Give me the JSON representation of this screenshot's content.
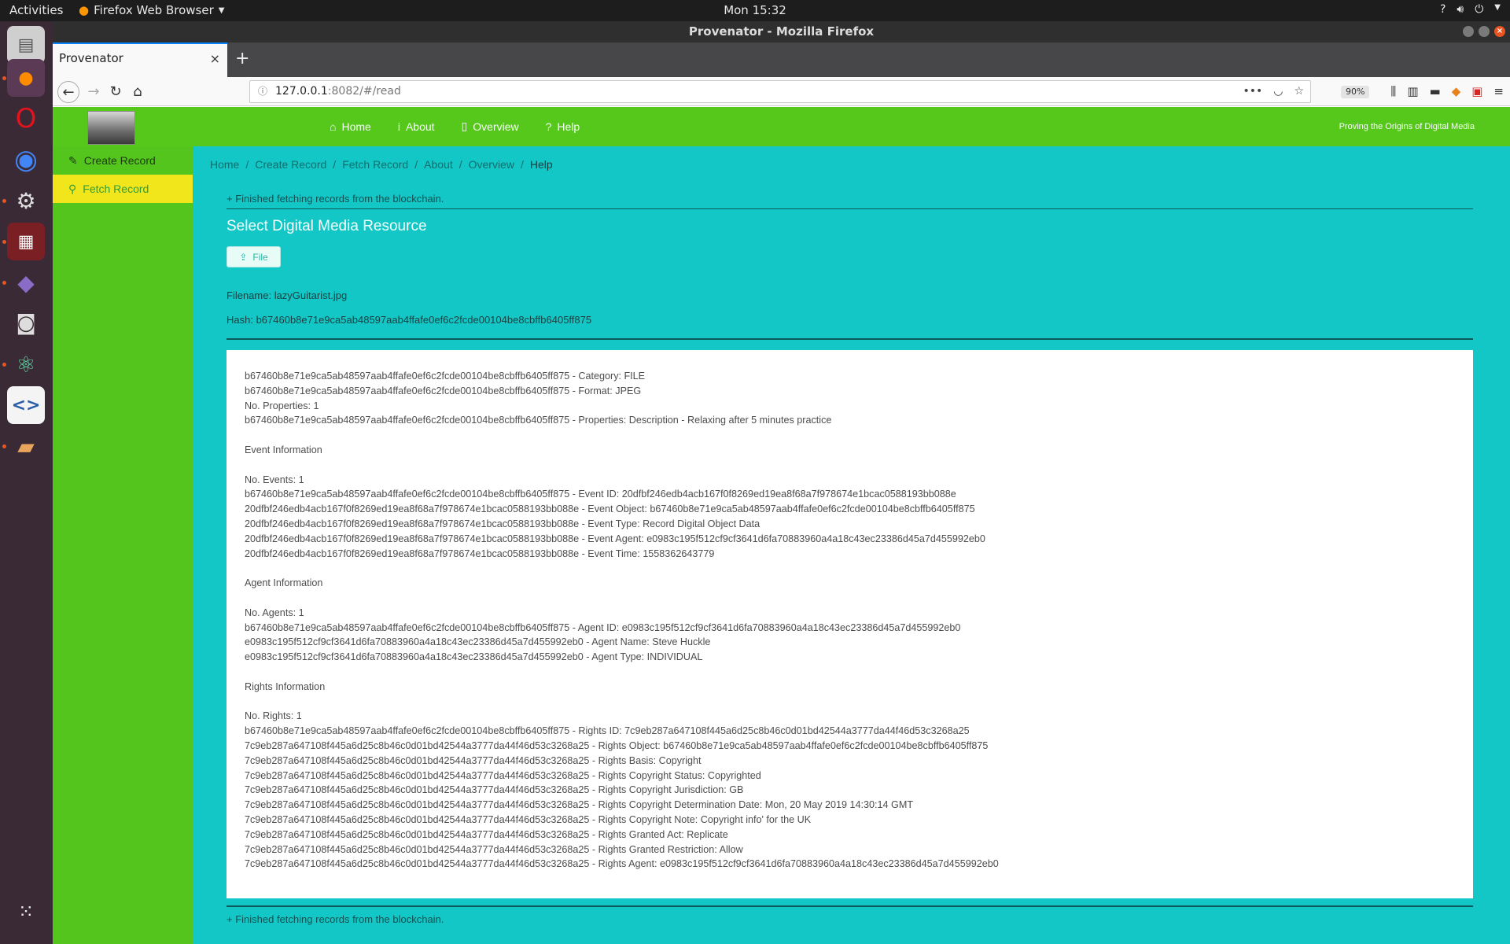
{
  "topbar": {
    "activities": "Activities",
    "app_name": "Firefox Web Browser",
    "clock": "Mon 15:32"
  },
  "window": {
    "title": "Provenator - Mozilla Firefox",
    "tab_title": "Provenator",
    "url_host": "127.0.0.1",
    "url_rest": ":8082/#/read",
    "zoom": "90%"
  },
  "header": {
    "nav": [
      "Home",
      "About",
      "Overview",
      "Help"
    ],
    "tagline": "Proving the Origins of Digital Media"
  },
  "sidebar": {
    "items": [
      "Create Record",
      "Fetch Record"
    ],
    "active_index": 1
  },
  "breadcrumb": [
    "Home",
    "Create Record",
    "Fetch Record",
    "About",
    "Overview",
    "Help"
  ],
  "main": {
    "status_top": "Finished fetching records from the blockchain.",
    "status_bottom": "Finished fetching records from the blockchain.",
    "title": "Select Digital Media Resource",
    "file_button": "File",
    "filename": "Filename: lazyGuitarist.jpg",
    "hash": "Hash: b67460b8e71e9ca5ab48597aab4ffafe0ef6c2fcde00104be8cbffb6405ff875",
    "result_lines": [
      "b67460b8e71e9ca5ab48597aab4ffafe0ef6c2fcde00104be8cbffb6405ff875 - Category: FILE",
      "b67460b8e71e9ca5ab48597aab4ffafe0ef6c2fcde00104be8cbffb6405ff875 - Format: JPEG",
      "No. Properties: 1",
      "b67460b8e71e9ca5ab48597aab4ffafe0ef6c2fcde00104be8cbffb6405ff875 - Properties: Description - Relaxing after 5 minutes practice",
      "",
      "Event Information",
      "",
      "No. Events: 1",
      "b67460b8e71e9ca5ab48597aab4ffafe0ef6c2fcde00104be8cbffb6405ff875 - Event ID: 20dfbf246edb4acb167f0f8269ed19ea8f68a7f978674e1bcac0588193bb088e",
      "20dfbf246edb4acb167f0f8269ed19ea8f68a7f978674e1bcac0588193bb088e - Event Object: b67460b8e71e9ca5ab48597aab4ffafe0ef6c2fcde00104be8cbffb6405ff875",
      "20dfbf246edb4acb167f0f8269ed19ea8f68a7f978674e1bcac0588193bb088e - Event Type: Record Digital Object Data",
      "20dfbf246edb4acb167f0f8269ed19ea8f68a7f978674e1bcac0588193bb088e - Event Agent: e0983c195f512cf9cf3641d6fa70883960a4a18c43ec23386d45a7d455992eb0",
      "20dfbf246edb4acb167f0f8269ed19ea8f68a7f978674e1bcac0588193bb088e - Event Time: 1558362643779",
      "",
      "Agent Information",
      "",
      "No. Agents: 1",
      "b67460b8e71e9ca5ab48597aab4ffafe0ef6c2fcde00104be8cbffb6405ff875 - Agent ID: e0983c195f512cf9cf3641d6fa70883960a4a18c43ec23386d45a7d455992eb0",
      "e0983c195f512cf9cf3641d6fa70883960a4a18c43ec23386d45a7d455992eb0 - Agent Name: Steve Huckle",
      "e0983c195f512cf9cf3641d6fa70883960a4a18c43ec23386d45a7d455992eb0 - Agent Type: INDIVIDUAL",
      "",
      "Rights Information",
      "",
      "No. Rights: 1",
      "b67460b8e71e9ca5ab48597aab4ffafe0ef6c2fcde00104be8cbffb6405ff875 - Rights ID: 7c9eb287a647108f445a6d25c8b46c0d01bd42544a3777da44f46d53c3268a25",
      "7c9eb287a647108f445a6d25c8b46c0d01bd42544a3777da44f46d53c3268a25 - Rights Object: b67460b8e71e9ca5ab48597aab4ffafe0ef6c2fcde00104be8cbffb6405ff875",
      "7c9eb287a647108f445a6d25c8b46c0d01bd42544a3777da44f46d53c3268a25 - Rights Basis: Copyright",
      "7c9eb287a647108f445a6d25c8b46c0d01bd42544a3777da44f46d53c3268a25 - Rights Copyright Status: Copyrighted",
      "7c9eb287a647108f445a6d25c8b46c0d01bd42544a3777da44f46d53c3268a25 - Rights Copyright Jurisdiction: GB",
      "7c9eb287a647108f445a6d25c8b46c0d01bd42544a3777da44f46d53c3268a25 - Rights Copyright Determination Date: Mon, 20 May 2019 14:30:14 GMT",
      "7c9eb287a647108f445a6d25c8b46c0d01bd42544a3777da44f46d53c3268a25 - Rights Copyright Note: Copyright info' for the UK",
      "7c9eb287a647108f445a6d25c8b46c0d01bd42544a3777da44f46d53c3268a25 - Rights Granted Act: Replicate",
      "7c9eb287a647108f445a6d25c8b46c0d01bd42544a3777da44f46d53c3268a25 - Rights Granted Restriction: Allow",
      "7c9eb287a647108f445a6d25c8b46c0d01bd42544a3777da44f46d53c3268a25 - Rights Agent: e0983c195f512cf9cf3641d6fa70883960a4a18c43ec23386d45a7d455992eb0"
    ]
  },
  "colors": {
    "header_green": "#56c81c",
    "content_teal": "#14c7c7",
    "active_yellow": "#f1e51c"
  }
}
